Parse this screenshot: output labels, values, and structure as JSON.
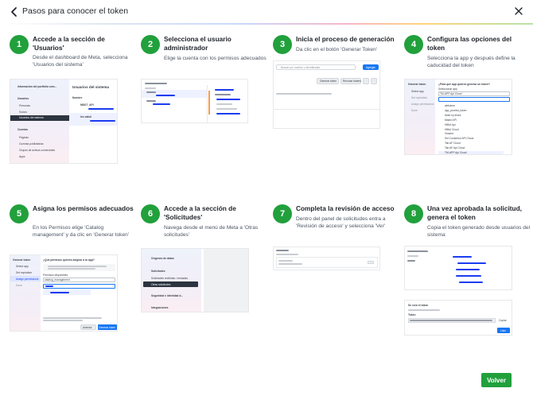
{
  "header": {
    "title": "Pasos para conocer el token"
  },
  "colors": {
    "accent": "#21a03c",
    "link_blue": "#1b3cf0"
  },
  "steps": [
    {
      "number": "1",
      "title": "Accede a la sección de 'Usuarios'",
      "desc": "Desde el dashboard de Meta, selecciona 'Usuarios del sistema'"
    },
    {
      "number": "2",
      "title": "Selecciona el usuario administrador",
      "desc": "Elige la cuenta con los permisos adecuados"
    },
    {
      "number": "3",
      "title": "Inicia el proceso de generación",
      "desc": "Da clic en el botón 'Generar Token'"
    },
    {
      "number": "4",
      "title": "Configura las opciones del token",
      "desc": "Selecciona la app y después define la caducidad del token"
    },
    {
      "number": "5",
      "title": "Asigna los permisos adecuados",
      "desc": "En los Permisos elige 'Catalog management' y da clic en 'Generar token'"
    },
    {
      "number": "6",
      "title": "Accede a la sección de 'Solicitudes'",
      "desc": "Navega desde el menú de Meta a 'Otras solicitudes'"
    },
    {
      "number": "7",
      "title": "Completa la revisión de acceso",
      "desc": "Dentro del panel de solicitudes entra a 'Revisión de acceso' y selecciona 'Ver'"
    },
    {
      "number": "8",
      "title": "Una vez aprobada la solicitud, genera el token",
      "desc": "Copia el token generado desde usuarios del sistema"
    }
  ],
  "shots": {
    "s1": {
      "portfolio": "Información del portfolio com...",
      "users_section": "Usuarios",
      "people": "Personas",
      "partners": "Socios",
      "system_users": "Usuarios del sistema",
      "accounts_section": "Cuentas",
      "pages": "Páginas",
      "ad_accounts": "Cuentas publicitarias",
      "dataset_groups": "Grupos de activos comerciales",
      "apps": "Apps",
      "panel_title": "Usuarios del sistema",
      "name_col": "Nombre",
      "user1": "NBOT_API",
      "user2": "lex catch"
    },
    "s3": {
      "search_placeholder": "Buscar por nombre o identificador",
      "add_button": "Agregar",
      "generate_token": "Generar token",
      "revoke_tokens": "Revocar tokens"
    },
    "s4": {
      "sidebar_title": "Generar token",
      "sb1": "Select app",
      "sb2": "Set expiration",
      "sb3": "Assign permissions",
      "sb4": "Done",
      "question": "¿Para qué app quieres generar un token?",
      "select_app": "Seleccionar app",
      "selected_value": "TM-APP Api Cloud",
      "options": [
        "wbfcimm",
        "app_prueba_token",
        "Alain ny tricks",
        "Makin API",
        "HiBot Api",
        "HiBot Cloud",
        "Vinsent",
        "Sel Consutmo API Cloud",
        "Tab AF Cloud",
        "Tab AF Api Cloud",
        "TM-APP Api Cloud"
      ]
    },
    "s5": {
      "sidebar_title": "Generar token",
      "sb1": "Select app",
      "sb2": "Set expiration",
      "sb3": "Assign permissions",
      "sb4": "Done",
      "question": "¿Qué permisos quieres asignar a tu app?",
      "perm_label": "Permisos disponibles",
      "perm_value": "catalog_management",
      "cancel": "Anterior",
      "generate": "Generar token"
    },
    "s6": {
      "m1": "Orígenes de datos",
      "m2": "Solicitudes",
      "sub1": "Solicitudes recibidas / enviadas",
      "sub2": "Otras solicitudes",
      "m3": "Seguridad e identidad d...",
      "m4": "Integraciones"
    },
    "s8": {
      "created_title": "Se creó el token",
      "token_label": "Token",
      "copy": "Copiar",
      "done": "Listo"
    }
  },
  "footer": {
    "button_label": "Volver"
  }
}
